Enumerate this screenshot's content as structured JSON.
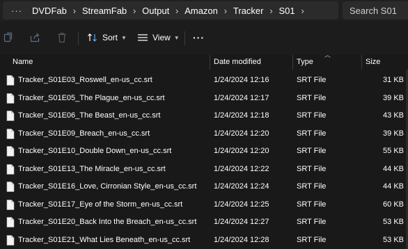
{
  "address_bar": {
    "more_label": "···",
    "breadcrumbs": [
      "DVDFab",
      "StreamFab",
      "Output",
      "Amazon",
      "Tracker",
      "S01"
    ],
    "separator": "›"
  },
  "search": {
    "placeholder": "Search S01"
  },
  "toolbar": {
    "icons": [
      "copy-icon",
      "share-icon",
      "delete-icon"
    ],
    "sort_label": "Sort",
    "view_label": "View",
    "more_label": "···"
  },
  "columns": {
    "name": "Name",
    "date_modified": "Date modified",
    "type": "Type",
    "size": "Size"
  },
  "files": [
    {
      "name": "Tracker_S01E03_Roswell_en-us_cc.srt",
      "date": "1/24/2024 12:16",
      "type": "SRT File",
      "size": "31 KB"
    },
    {
      "name": "Tracker_S01E05_The Plague_en-us_cc.srt",
      "date": "1/24/2024 12:17",
      "type": "SRT File",
      "size": "39 KB"
    },
    {
      "name": "Tracker_S01E06_The Beast_en-us_cc.srt",
      "date": "1/24/2024 12:18",
      "type": "SRT File",
      "size": "43 KB"
    },
    {
      "name": "Tracker_S01E09_Breach_en-us_cc.srt",
      "date": "1/24/2024 12:20",
      "type": "SRT File",
      "size": "39 KB"
    },
    {
      "name": "Tracker_S01E10_Double Down_en-us_cc.srt",
      "date": "1/24/2024 12:20",
      "type": "SRT File",
      "size": "55 KB"
    },
    {
      "name": "Tracker_S01E13_The Miracle_en-us_cc.srt",
      "date": "1/24/2024 12:22",
      "type": "SRT File",
      "size": "44 KB"
    },
    {
      "name": "Tracker_S01E16_Love, Cirronian Style_en-us_cc.srt",
      "date": "1/24/2024 12:24",
      "type": "SRT File",
      "size": "44 KB"
    },
    {
      "name": "Tracker_S01E17_Eye of the Storm_en-us_cc.srt",
      "date": "1/24/2024 12:25",
      "type": "SRT File",
      "size": "60 KB"
    },
    {
      "name": "Tracker_S01E20_Back Into the Breach_en-us_cc.srt",
      "date": "1/24/2024 12:27",
      "type": "SRT File",
      "size": "53 KB"
    },
    {
      "name": "Tracker_S01E21_What Lies Beneath_en-us_cc.srt",
      "date": "1/24/2024 12:28",
      "type": "SRT File",
      "size": "53 KB"
    }
  ]
}
